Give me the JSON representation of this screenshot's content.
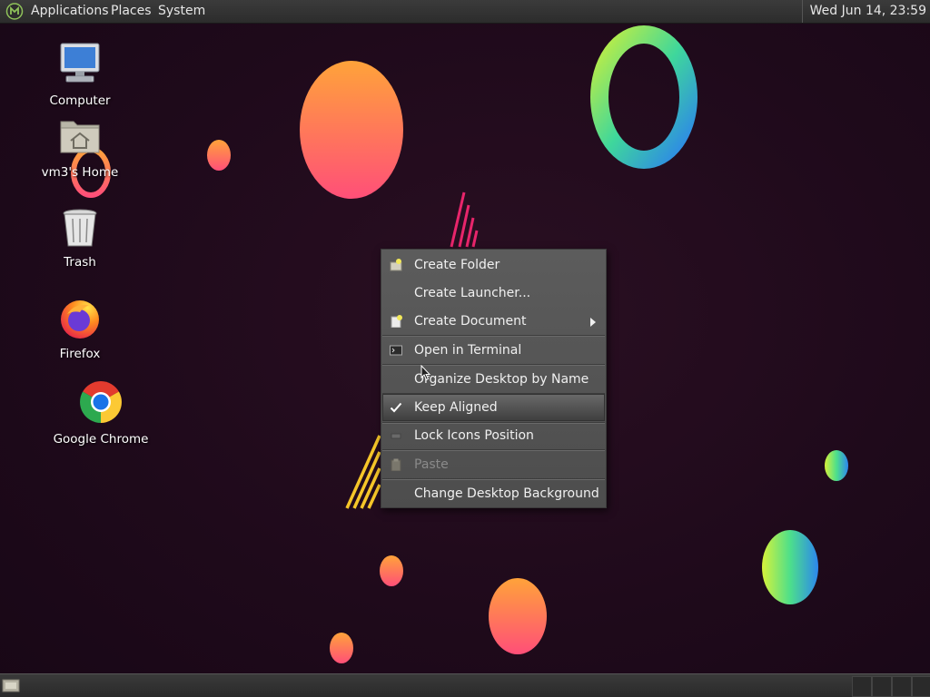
{
  "top_panel": {
    "menus": [
      "Applications",
      "Places",
      "System"
    ],
    "clock": "Wed Jun 14, 23:59"
  },
  "desktop_icons": [
    {
      "label": "Computer",
      "icon": "computer-icon"
    },
    {
      "label": "vm3's Home",
      "icon": "home-folder-icon"
    },
    {
      "label": "Trash",
      "icon": "trash-icon"
    },
    {
      "label": "Firefox",
      "icon": "firefox-icon"
    },
    {
      "label": "Google Chrome",
      "icon": "chrome-icon"
    }
  ],
  "context_menu": {
    "items": [
      {
        "label": "Create Folder",
        "icon": "new-folder-icon"
      },
      {
        "label": "Create Launcher...",
        "icon": ""
      },
      {
        "label": "Create Document",
        "icon": "new-document-icon",
        "submenu": true
      },
      {
        "label": "Open in Terminal",
        "icon": "terminal-icon"
      },
      {
        "label": "Organize Desktop by Name",
        "icon": ""
      },
      {
        "label": "Keep Aligned",
        "icon": "checkmark-icon",
        "checked": true,
        "highlighted": true
      },
      {
        "label": "Lock Icons Position",
        "icon": "lock-icon"
      },
      {
        "label": "Paste",
        "icon": "paste-icon",
        "disabled": true
      },
      {
        "label": "Change Desktop Background",
        "icon": ""
      }
    ]
  },
  "colors": {
    "desktop_background": "#1f0a1b",
    "panel": "#333333",
    "menu_background": "#555555",
    "menu_text": "#f0f0f0"
  }
}
